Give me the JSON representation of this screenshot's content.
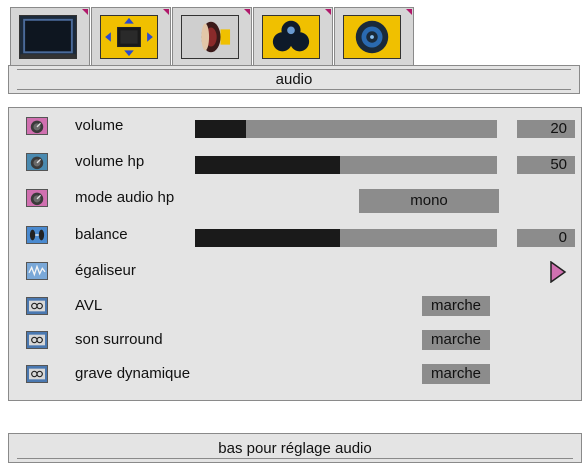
{
  "tabs": [
    {
      "icon": "tv-screen-icon",
      "active": true
    },
    {
      "icon": "picture-adjust-icon",
      "active": false
    },
    {
      "icon": "speaker-icon",
      "active": true
    },
    {
      "icon": "features-icon",
      "active": false
    },
    {
      "icon": "setup-icon",
      "active": false
    }
  ],
  "title": "audio",
  "colors": {
    "panel": "#e4e4e4",
    "bar_bg": "#8c8c8c",
    "bar_fill": "#1a1a1a",
    "accent": "#b0186a",
    "icon_yellow": "#f0c000"
  },
  "menu": {
    "volume": {
      "label": "volume",
      "value": "20",
      "level": 0.17,
      "icon": "volume-dial-icon"
    },
    "volume_hp": {
      "label": "volume hp",
      "value": "50",
      "level": 0.48,
      "icon": "volume-dial-icon"
    },
    "mode_audio_hp": {
      "label": "mode audio hp",
      "value": "mono",
      "icon": "volume-dial-icon"
    },
    "balance": {
      "label": "balance",
      "value": "0",
      "level": 0.48,
      "icon": "balance-icon"
    },
    "egaliseur": {
      "label": "égaliseur",
      "icon": "equalizer-icon"
    },
    "avl": {
      "label": "AVL",
      "value": "marche",
      "icon": "dolby-icon"
    },
    "son_surround": {
      "label": "son surround",
      "value": "marche",
      "icon": "dolby-icon"
    },
    "grave_dynamique": {
      "label": "grave dynamique",
      "value": "marche",
      "icon": "dolby-icon"
    }
  },
  "hint": "bas pour réglage audio"
}
